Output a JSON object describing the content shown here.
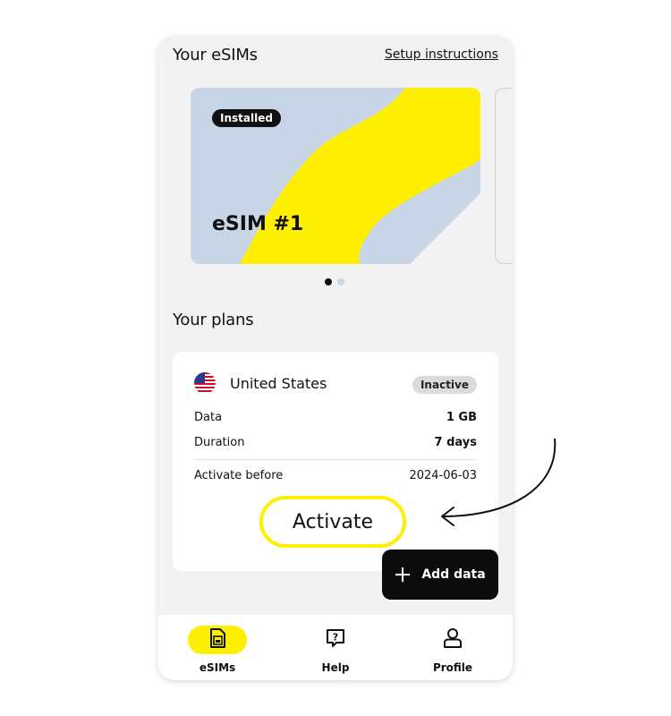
{
  "colors": {
    "accent_yellow": "#ffef00",
    "card_blue": "#c8d5e7",
    "background": "#f2f2f2",
    "dark": "#111111"
  },
  "header": {
    "title": "Your eSIMs",
    "setup_link": "Setup instructions"
  },
  "esim_card": {
    "badge": "Installed",
    "name": "eSIM #1"
  },
  "carousel": {
    "dots": [
      {
        "active": true
      },
      {
        "active": false
      }
    ]
  },
  "plans": {
    "title": "Your plans",
    "items": [
      {
        "flag_icon": "us-flag-icon",
        "country": "United States",
        "status": "Inactive",
        "rows": [
          {
            "label": "Data",
            "value": "1 GB"
          },
          {
            "label": "Duration",
            "value": "7 days"
          }
        ],
        "activate_before": {
          "label": "Activate before",
          "value": "2024-06-03"
        }
      }
    ]
  },
  "actions": {
    "activate": "Activate",
    "add_data": "Add data"
  },
  "tabbar": {
    "items": [
      {
        "label": "eSIMs",
        "icon": "sim-card-icon",
        "active": true
      },
      {
        "label": "Help",
        "icon": "help-bubble-icon",
        "active": false
      },
      {
        "label": "Profile",
        "icon": "profile-icon",
        "active": false
      }
    ]
  }
}
